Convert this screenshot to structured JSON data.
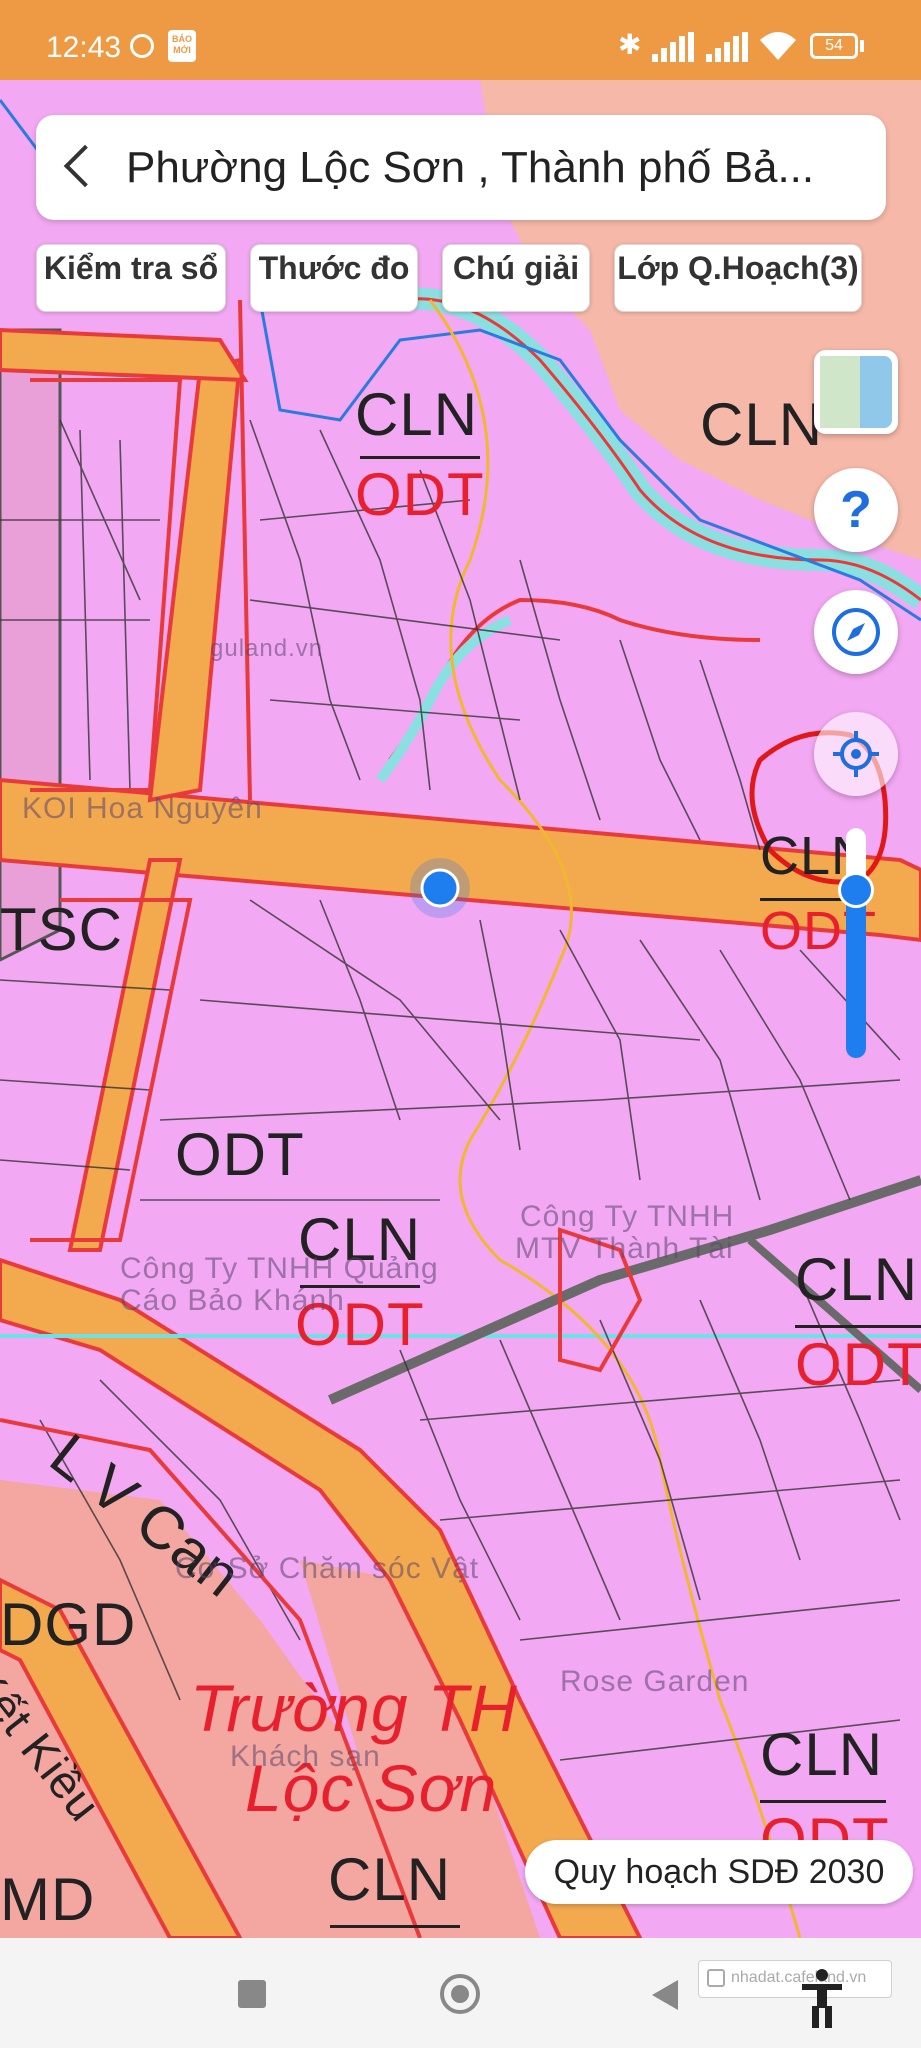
{
  "status_bar": {
    "time": "12:43",
    "app_badge": "BÁO MỚI",
    "signal_1": "signal-bars-icon",
    "signal_2": "signal-bars-icon",
    "battery_level": "54"
  },
  "header": {
    "title": "Phường Lộc Sơn , Thành phố Bả..."
  },
  "toolbar": {
    "buttons": [
      {
        "label": "Kiểm tra sổ"
      },
      {
        "label": "Thước đo"
      },
      {
        "label": "Chú giải"
      },
      {
        "label": "Lớp Q.Hoạch(3)"
      }
    ]
  },
  "controls": {
    "help_label": "?"
  },
  "map": {
    "labels": {
      "cln_top": "CLN",
      "odt_top": "ODT",
      "cln_top_right": "CLN",
      "tsc": "TSC",
      "odt_mid": "ODT",
      "cln_mid": "CLN",
      "odt_mid2": "ODT",
      "cln_right": "CLN",
      "odt_right": "ODT",
      "cln_marked": "CLN",
      "odt_marked": "ODT",
      "cln_bottom_right": "CLN",
      "odt_bottom_right": "ODT",
      "cln_bottom": "CLN",
      "dgd_bottom": "DGD",
      "dgd_left": "DGD",
      "md_left": "MD",
      "road_lvcan": "L V Can",
      "school_line1": "Trường TH",
      "school_line2": "Lộc Sơn",
      "road_keikieu": "Kết Kiều",
      "poi_koi": "KOI Hoa Nguyên",
      "poi_company1": "Công Ty TNHH",
      "poi_company1b": "MTV Thành Tài",
      "poi_company2": "Công Ty TNHH Quảng",
      "poi_company2b": "Cáo Bảo Khánh",
      "poi_rose": "Rose Garden",
      "poi_store": "Cơ Sở Chăm sóc Vật",
      "poi_hotel": "Khách sạn",
      "watermark": "guland.vn"
    }
  },
  "plan_badge": "Quy hoạch SDĐ 2030",
  "watermark_corner": "nhadat.cafeland.vn"
}
